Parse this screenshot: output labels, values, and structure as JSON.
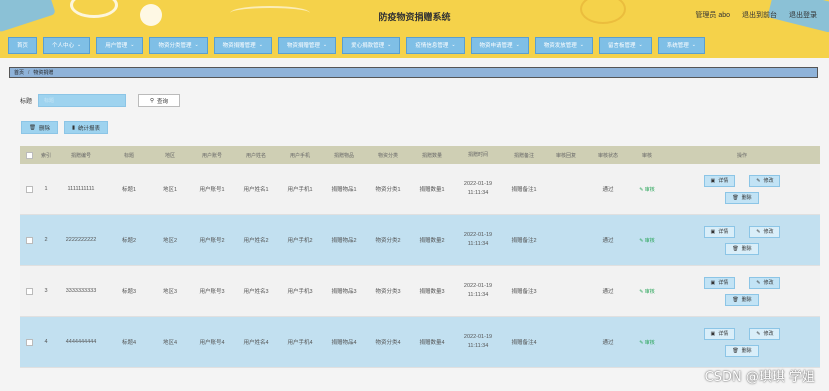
{
  "header": {
    "title": "防疫物资捐赠系统",
    "user_label": "管理员 abo",
    "back_to_front": "退出到前台",
    "logout": "退出登录"
  },
  "nav": {
    "items": [
      {
        "label": "首页",
        "caret": false
      },
      {
        "label": "个人中心",
        "caret": true
      },
      {
        "label": "用户管理",
        "caret": true
      },
      {
        "label": "物资分类管理",
        "caret": true
      },
      {
        "label": "物资捐赠管理",
        "caret": true
      },
      {
        "label": "物资捐赠管理",
        "caret": true
      },
      {
        "label": "爱心捐款管理",
        "caret": true
      },
      {
        "label": "疫情信息管理",
        "caret": true
      },
      {
        "label": "物资申请管理",
        "caret": true
      },
      {
        "label": "物资发放管理",
        "caret": true
      },
      {
        "label": "留言板管理",
        "caret": true
      },
      {
        "label": "系统管理",
        "caret": true
      }
    ]
  },
  "breadcrumb": {
    "home": "首页",
    "sep": "/",
    "current": "物资捐赠"
  },
  "search": {
    "label": "标题",
    "placeholder": "标题",
    "button": "查询"
  },
  "actions": {
    "delete": "删除",
    "stats": "统计报表"
  },
  "table": {
    "headers": [
      "索引",
      "捐赠编号",
      "标题",
      "地区",
      "用户账号",
      "用户姓名",
      "用户手机",
      "捐赠物品",
      "物资分类",
      "捐赠数量",
      "捐赠时间",
      "捐赠备注",
      "审核回复",
      "审核状态",
      "审核",
      "操作"
    ],
    "rows": [
      {
        "idx": "1",
        "no": "1111111111",
        "title": "标题1",
        "area": "地区1",
        "account": "用户账号1",
        "name": "用户姓名1",
        "phone": "用户手机1",
        "goods": "捐赠物品1",
        "category": "物资分类1",
        "qty": "捐赠数量1",
        "date": "2022-01-19",
        "time": "11:11:34",
        "remark": "捐赠备注1",
        "reply": "",
        "status": "通过",
        "audit": "审核"
      },
      {
        "idx": "2",
        "no": "2222222222",
        "title": "标题2",
        "area": "地区2",
        "account": "用户账号2",
        "name": "用户姓名2",
        "phone": "用户手机2",
        "goods": "捐赠物品2",
        "category": "物资分类2",
        "qty": "捐赠数量2",
        "date": "2022-01-19",
        "time": "11:11:34",
        "remark": "捐赠备注2",
        "reply": "",
        "status": "通过",
        "audit": "审核"
      },
      {
        "idx": "3",
        "no": "3333333333",
        "title": "标题3",
        "area": "地区3",
        "account": "用户账号3",
        "name": "用户姓名3",
        "phone": "用户手机3",
        "goods": "捐赠物品3",
        "category": "物资分类3",
        "qty": "捐赠数量3",
        "date": "2022-01-19",
        "time": "11:11:34",
        "remark": "捐赠备注3",
        "reply": "",
        "status": "通过",
        "audit": "审核"
      },
      {
        "idx": "4",
        "no": "4444444444",
        "title": "标题4",
        "area": "地区4",
        "account": "用户账号4",
        "name": "用户姓名4",
        "phone": "用户手机4",
        "goods": "捐赠物品4",
        "category": "物资分类4",
        "qty": "捐赠数量4",
        "date": "2022-01-19",
        "time": "11:11:34",
        "remark": "捐赠备注4",
        "reply": "",
        "status": "通过",
        "audit": "审核"
      }
    ],
    "op_labels": {
      "detail": "详情",
      "edit": "修改",
      "delete": "删除"
    }
  },
  "watermark": "CSDN @琪琪 学姐",
  "colors": {
    "header": "#f5d24a",
    "nav_item": "#7fbfe6",
    "row_even": "#c2e0f0",
    "table_head": "#cfcfb4"
  }
}
